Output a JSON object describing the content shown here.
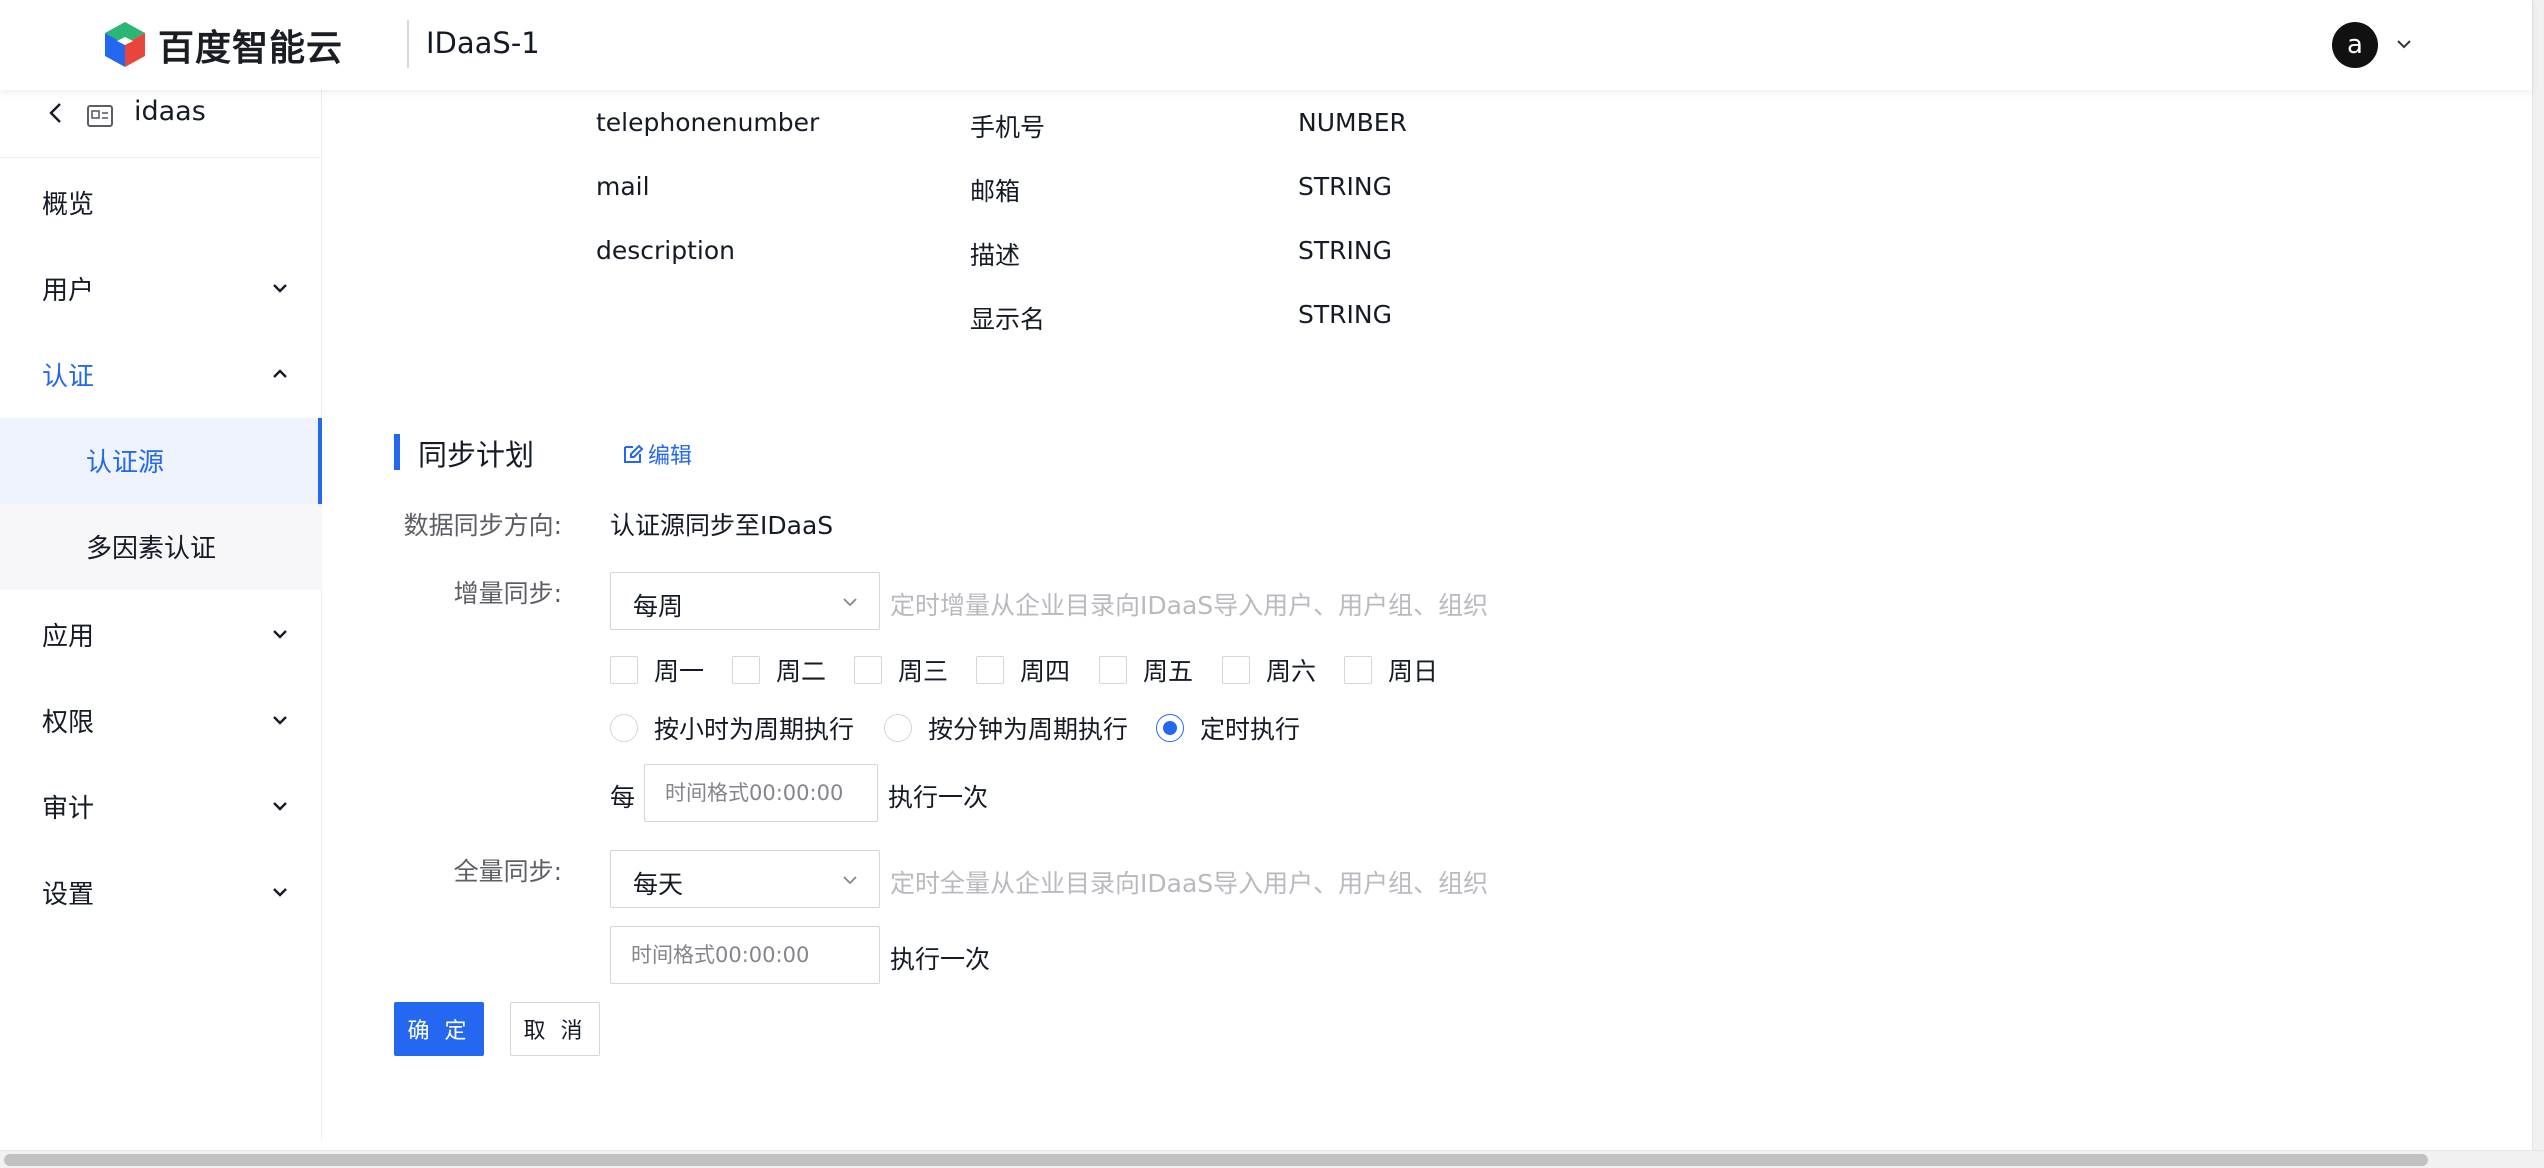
{
  "header": {
    "brand": "百度智能云",
    "app_title": "IDaaS-1",
    "avatar_letter": "a"
  },
  "sidebar": {
    "instance": "idaas",
    "items": [
      {
        "label": "概览"
      },
      {
        "label": "用户"
      },
      {
        "label": "认证"
      },
      {
        "label": "认证源"
      },
      {
        "label": "多因素认证"
      },
      {
        "label": "应用"
      },
      {
        "label": "权限"
      },
      {
        "label": "审计"
      },
      {
        "label": "设置"
      }
    ]
  },
  "attributes": [
    {
      "name": "telephonenumber",
      "display": "手机号",
      "type": "NUMBER"
    },
    {
      "name": "mail",
      "display": "邮箱",
      "type": "STRING"
    },
    {
      "name": "description",
      "display": "描述",
      "type": "STRING"
    },
    {
      "name": "",
      "display": "显示名",
      "type": "STRING"
    }
  ],
  "sync_plan": {
    "title": "同步计划",
    "edit_label": "编辑",
    "direction_label": "数据同步方向:",
    "direction_value": "认证源同步至IDaaS",
    "incremental": {
      "label": "增量同步:",
      "selected": "每周",
      "hint": "定时增量从企业目录向IDaaS导入用户、用户组、组织",
      "weekdays": [
        "周一",
        "周二",
        "周三",
        "周四",
        "周五",
        "周六",
        "周日"
      ],
      "modes": [
        "按小时为周期执行",
        "按分钟为周期执行",
        "定时执行"
      ],
      "selected_mode": "定时执行",
      "every_prefix": "每",
      "time_placeholder": "时间格式00:00:00",
      "suffix": "执行一次"
    },
    "full": {
      "label": "全量同步:",
      "selected": "每天",
      "hint": "定时全量从企业目录向IDaaS导入用户、用户组、组织",
      "time_placeholder": "时间格式00:00:00",
      "suffix": "执行一次"
    },
    "confirm_label": "确 定",
    "cancel_label": "取 消"
  },
  "colors": {
    "accent": "#2468f2",
    "text": "#151b26",
    "hint": "#b8babf"
  }
}
